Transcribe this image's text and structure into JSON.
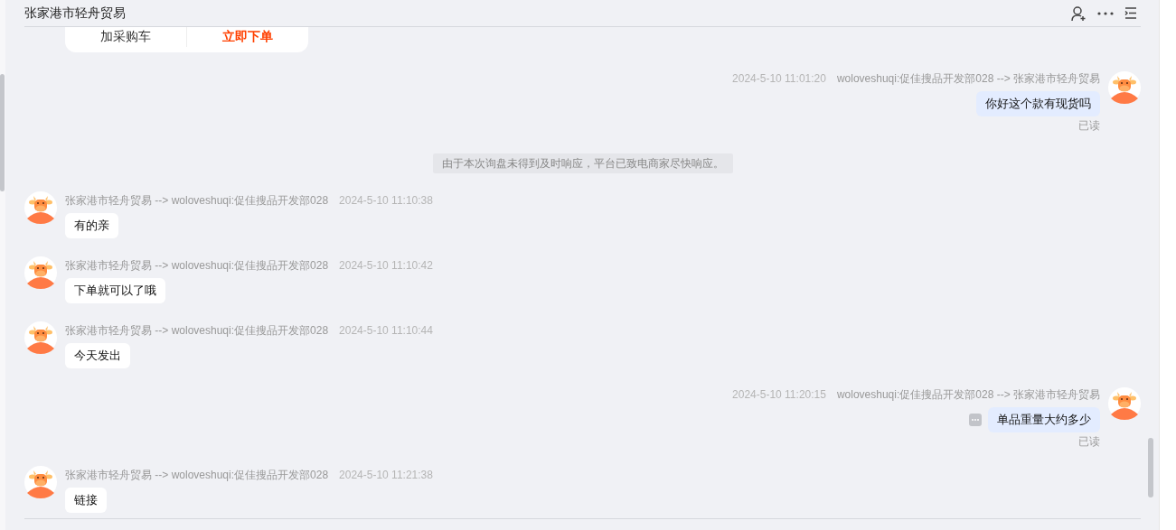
{
  "header": {
    "title": "张家港市轻舟贸易"
  },
  "product_card": {
    "buttons": [
      {
        "label": "加采购车",
        "kind": "secondary"
      },
      {
        "label": "立即下单",
        "kind": "primary"
      }
    ]
  },
  "messages": [
    {
      "kind": "outgoing",
      "time": "2024-5-10 11:01:20",
      "route": "woloveshuqi:促佳搜品开发部028 --> 张家港市轻舟贸易",
      "text": "你好这个款有现货吗",
      "status": "已读",
      "has_more": false
    },
    {
      "kind": "notice",
      "text": "由于本次询盘未得到及时响应，平台已致电商家尽快响应。"
    },
    {
      "kind": "incoming",
      "time": "2024-5-10 11:10:38",
      "route": "张家港市轻舟贸易 --> woloveshuqi:促佳搜品开发部028",
      "text": "有的亲"
    },
    {
      "kind": "incoming",
      "time": "2024-5-10 11:10:42",
      "route": "张家港市轻舟贸易 --> woloveshuqi:促佳搜品开发部028",
      "text": "下单就可以了哦"
    },
    {
      "kind": "incoming",
      "time": "2024-5-10 11:10:44",
      "route": "张家港市轻舟贸易 --> woloveshuqi:促佳搜品开发部028",
      "text": "今天发出"
    },
    {
      "kind": "outgoing",
      "time": "2024-5-10 11:20:15",
      "route": "woloveshuqi:促佳搜品开发部028 --> 张家港市轻舟贸易",
      "text": "单品重量大约多少",
      "status": "已读",
      "has_more": true
    },
    {
      "kind": "incoming",
      "time": "2024-5-10 11:21:38",
      "route": "张家港市轻舟贸易 --> woloveshuqi:促佳搜品开发部028",
      "text": "链接"
    }
  ]
}
